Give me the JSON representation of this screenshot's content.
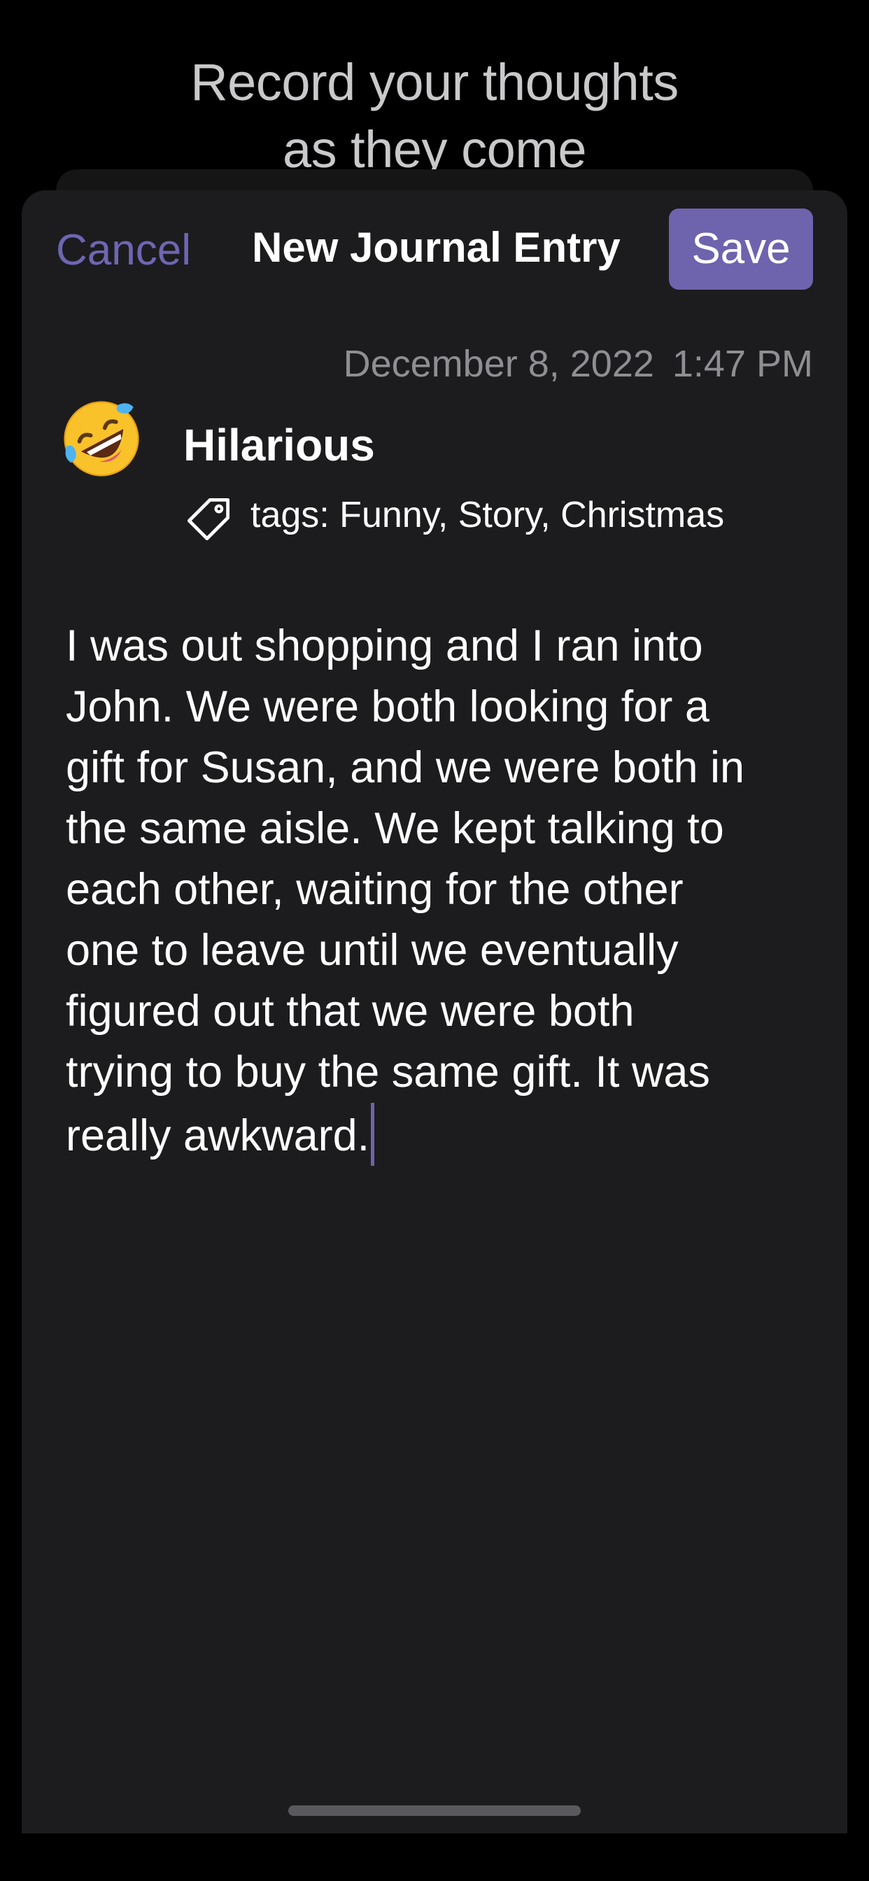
{
  "promo": {
    "caption_line1": "Record your thoughts",
    "caption_line2": "as they come"
  },
  "nav": {
    "cancel_label": "Cancel",
    "title": "New Journal Entry",
    "save_label": "Save"
  },
  "entry": {
    "date": "December 8, 2022",
    "time": "1:47 PM",
    "mood_icon": "rolling-on-floor-laughing-emoji",
    "mood_label": "Hilarious",
    "tags_icon": "tag-icon",
    "tags_text": "tags: Funny, Story, Christmas",
    "body_lines": [
      "I was out shopping and I ran into",
      "John.  We were both looking for a",
      "gift for Susan, and we were both in",
      "the same aisle.  We kept talking to",
      "each other, waiting for the other",
      "one to leave until we eventually",
      "figured out that we were both",
      "trying to buy the same gift.  It was",
      "really awkward."
    ]
  },
  "colors": {
    "accent": "#6e63ad",
    "sheet_background": "#1c1c1e",
    "page_background": "#000000",
    "secondary_text": "#8e8e93"
  }
}
